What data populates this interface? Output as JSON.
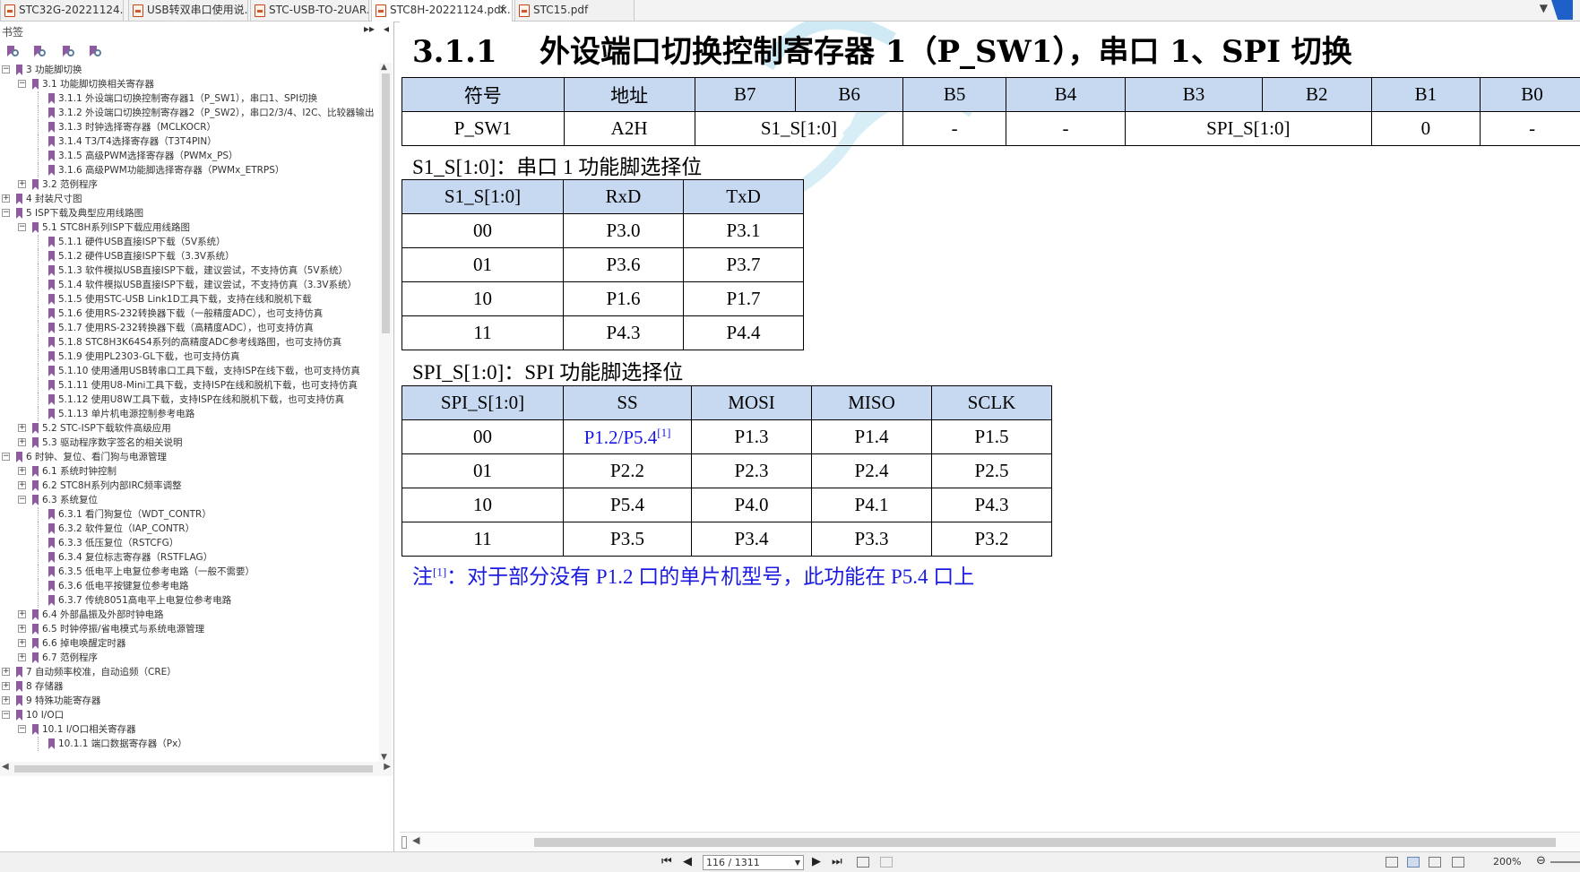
{
  "tabs": [
    {
      "label": "STC32G-20221124....",
      "active": false,
      "closable": false
    },
    {
      "label": "USB转双串口使用说...",
      "active": false,
      "closable": false
    },
    {
      "label": "STC-USB-TO-2UAR...",
      "active": false,
      "closable": false
    },
    {
      "label": "STC8H-20221124.pdf...",
      "active": true,
      "closable": true
    },
    {
      "label": "STC15.pdf",
      "active": false,
      "closable": false
    }
  ],
  "tab_close_glyph": "×",
  "tab_menu_glyph": "▼",
  "sidebar": {
    "title": "书签",
    "collapse_glyph": "▸▸",
    "pin_glyph": "◂",
    "tools": [
      "bookmark-expand-icon",
      "bookmark-collapse-icon",
      "bookmark-add-icon",
      "bookmark-find-icon"
    ]
  },
  "toc": [
    {
      "level": 0,
      "toggle": "-",
      "label": "3 功能脚切换"
    },
    {
      "level": 1,
      "toggle": "-",
      "label": "3.1 功能脚切换相关寄存器"
    },
    {
      "level": 2,
      "toggle": "",
      "label": "3.1.1 外设端口切换控制寄存器1（P_SW1），串口1、SPI切换"
    },
    {
      "level": 2,
      "toggle": "",
      "label": "3.1.2 外设端口切换控制寄存器2（P_SW2），串口2/3/4、I2C、比较器输出"
    },
    {
      "level": 2,
      "toggle": "",
      "label": "3.1.3 时钟选择寄存器（MCLKOCR）"
    },
    {
      "level": 2,
      "toggle": "",
      "label": "3.1.4 T3/T4选择寄存器（T3T4PIN）"
    },
    {
      "level": 2,
      "toggle": "",
      "label": "3.1.5 高级PWM选择寄存器（PWMx_PS）"
    },
    {
      "level": 2,
      "toggle": "",
      "label": "3.1.6 高级PWM功能脚选择寄存器（PWMx_ETRPS）"
    },
    {
      "level": 1,
      "toggle": "+",
      "label": "3.2 范例程序"
    },
    {
      "level": 0,
      "toggle": "+",
      "label": "4 封装尺寸图"
    },
    {
      "level": 0,
      "toggle": "-",
      "label": "5 ISP下载及典型应用线路图"
    },
    {
      "level": 1,
      "toggle": "-",
      "label": "5.1 STC8H系列ISP下载应用线路图"
    },
    {
      "level": 2,
      "toggle": "",
      "label": "5.1.1 硬件USB直接ISP下载（5V系统）"
    },
    {
      "level": 2,
      "toggle": "",
      "label": "5.1.2 硬件USB直接ISP下载（3.3V系统）"
    },
    {
      "level": 2,
      "toggle": "",
      "label": "5.1.3 软件模拟USB直接ISP下载，建议尝试，不支持仿真（5V系统）"
    },
    {
      "level": 2,
      "toggle": "",
      "label": "5.1.4 软件模拟USB直接ISP下载，建议尝试，不支持仿真（3.3V系统）"
    },
    {
      "level": 2,
      "toggle": "",
      "label": "5.1.5 使用STC-USB Link1D工具下载，支持在线和脱机下载"
    },
    {
      "level": 2,
      "toggle": "",
      "label": "5.1.6 使用RS-232转换器下载（一般精度ADC），也可支持仿真"
    },
    {
      "level": 2,
      "toggle": "",
      "label": "5.1.7 使用RS-232转换器下载（高精度ADC），也可支持仿真"
    },
    {
      "level": 2,
      "toggle": "",
      "label": "5.1.8 STC8H3K64S4系列的高精度ADC参考线路图，也可支持仿真"
    },
    {
      "level": 2,
      "toggle": "",
      "label": "5.1.9 使用PL2303-GL下载，也可支持仿真"
    },
    {
      "level": 2,
      "toggle": "",
      "label": "5.1.10 使用通用USB转串口工具下载，支持ISP在线下载，也可支持仿真"
    },
    {
      "level": 2,
      "toggle": "",
      "label": "5.1.11 使用U8-Mini工具下载，支持ISP在线和脱机下载，也可支持仿真"
    },
    {
      "level": 2,
      "toggle": "",
      "label": "5.1.12 使用U8W工具下载，支持ISP在线和脱机下载，也可支持仿真"
    },
    {
      "level": 2,
      "toggle": "",
      "label": "5.1.13 单片机电源控制参考电路"
    },
    {
      "level": 1,
      "toggle": "+",
      "label": "5.2 STC-ISP下载软件高级应用"
    },
    {
      "level": 1,
      "toggle": "+",
      "label": "5.3 驱动程序数字签名的相关说明"
    },
    {
      "level": 0,
      "toggle": "-",
      "label": "6 时钟、复位、看门狗与电源管理"
    },
    {
      "level": 1,
      "toggle": "+",
      "label": "6.1 系统时钟控制"
    },
    {
      "level": 1,
      "toggle": "+",
      "label": "6.2 STC8H系列内部IRC频率调整"
    },
    {
      "level": 1,
      "toggle": "-",
      "label": "6.3 系统复位"
    },
    {
      "level": 2,
      "toggle": "",
      "label": "6.3.1 看门狗复位（WDT_CONTR）"
    },
    {
      "level": 2,
      "toggle": "",
      "label": "6.3.2 软件复位（IAP_CONTR）"
    },
    {
      "level": 2,
      "toggle": "",
      "label": "6.3.3 低压复位（RSTCFG）"
    },
    {
      "level": 2,
      "toggle": "",
      "label": "6.3.4 复位标志寄存器（RSTFLAG）"
    },
    {
      "level": 2,
      "toggle": "",
      "label": "6.3.5 低电平上电复位参考电路（一般不需要）"
    },
    {
      "level": 2,
      "toggle": "",
      "label": "6.3.6 低电平按键复位参考电路"
    },
    {
      "level": 2,
      "toggle": "",
      "label": "6.3.7 传统8051高电平上电复位参考电路"
    },
    {
      "level": 1,
      "toggle": "+",
      "label": "6.4 外部晶振及外部时钟电路"
    },
    {
      "level": 1,
      "toggle": "+",
      "label": "6.5 时钟停振/省电模式与系统电源管理"
    },
    {
      "level": 1,
      "toggle": "+",
      "label": "6.6 掉电唤醒定时器"
    },
    {
      "level": 1,
      "toggle": "+",
      "label": "6.7 范例程序"
    },
    {
      "level": 0,
      "toggle": "+",
      "label": "7 自动频率校准，自动追频（CRE）"
    },
    {
      "level": 0,
      "toggle": "+",
      "label": "8 存储器"
    },
    {
      "level": 0,
      "toggle": "+",
      "label": "9 特殊功能寄存器"
    },
    {
      "level": 0,
      "toggle": "-",
      "label": "10 I/O口"
    },
    {
      "level": 1,
      "toggle": "-",
      "label": "10.1 I/O口相关寄存器"
    },
    {
      "level": 2,
      "toggle": "",
      "label": "10.1.1 端口数据寄存器（Px）"
    }
  ],
  "doc": {
    "heading_num": "3.1.1",
    "heading_text": "外设端口切换控制寄存器 1（P_SW1），串口 1、SPI 切换",
    "reg_table": {
      "headers": [
        "符号",
        "地址",
        "B7",
        "B6",
        "B5",
        "B4",
        "B3",
        "B2",
        "B1",
        "B0"
      ],
      "row": {
        "symbol": "P_SW1",
        "address": "A2H",
        "b7_b6": "S1_S[1:0]",
        "b5": "-",
        "b4": "-",
        "b3_b2": "SPI_S[1:0]",
        "b1": "0",
        "b0": "-"
      }
    },
    "s1_title": "S1_S[1:0]：串口 1 功能脚选择位",
    "s1_table": {
      "headers": [
        "S1_S[1:0]",
        "RxD",
        "TxD"
      ],
      "rows": [
        [
          "00",
          "P3.0",
          "P3.1"
        ],
        [
          "01",
          "P3.6",
          "P3.7"
        ],
        [
          "10",
          "P1.6",
          "P1.7"
        ],
        [
          "11",
          "P4.3",
          "P4.4"
        ]
      ]
    },
    "spi_title": "SPI_S[1:0]：SPI 功能脚选择位",
    "spi_table": {
      "headers": [
        "SPI_S[1:0]",
        "SS",
        "MOSI",
        "MISO",
        "SCLK"
      ],
      "rows": [
        [
          "00",
          "P1.2/P5.4",
          "P1.3",
          "P1.4",
          "P1.5"
        ],
        [
          "01",
          "P2.2",
          "P2.3",
          "P2.4",
          "P2.5"
        ],
        [
          "10",
          "P5.4",
          "P4.0",
          "P4.1",
          "P4.3"
        ],
        [
          "11",
          "P3.5",
          "P3.4",
          "P3.3",
          "P3.2"
        ]
      ],
      "ss_note_ref": "[1]"
    },
    "note_prefix": "注",
    "note_ref": "[1]",
    "note_text": "：对于部分没有 P1.2 口的单片机型号，此功能在 P5.4 口上",
    "watermark": "STC"
  },
  "statusbar": {
    "page_display": "116 / 1311",
    "first_glyph": "⏮",
    "prev_glyph": "◀",
    "next_glyph": "▶",
    "last_glyph": "⏭",
    "zoom": "200%",
    "zoom_out_glyph": "⊖"
  },
  "colors": {
    "table_header": "#c6d9f1",
    "note_blue": "#1a1ae0",
    "bookmark": "#8e5aa0"
  }
}
